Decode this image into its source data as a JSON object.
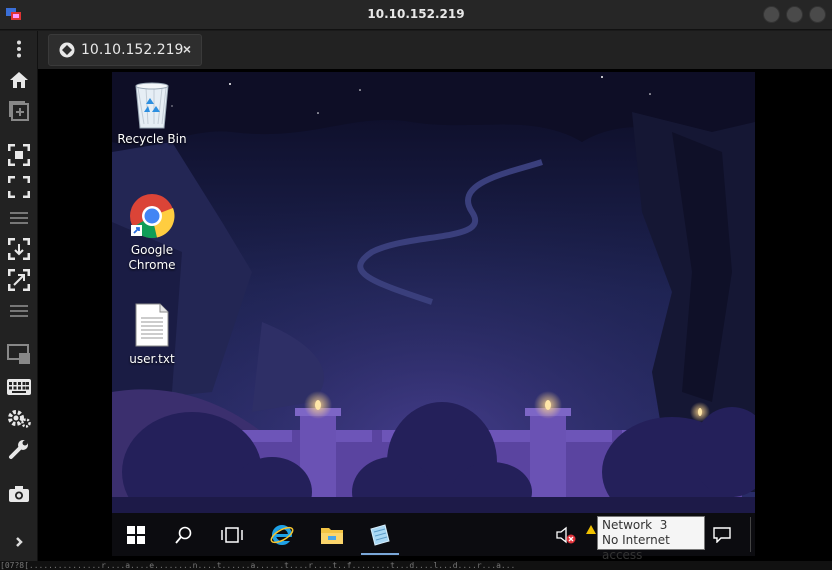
{
  "window": {
    "title": "10.10.152.219"
  },
  "tab": {
    "title": "10.10.152.219",
    "close": "×"
  },
  "sidebar": {
    "items": [
      {
        "icon": "kebab-menu-icon"
      },
      {
        "icon": "home-icon"
      },
      {
        "icon": "new-window-icon"
      },
      {
        "icon": "fit-screen-icon"
      },
      {
        "icon": "fullscreen-icon"
      },
      {
        "icon": "separator-icon"
      },
      {
        "icon": "shrink-icon"
      },
      {
        "icon": "expand-icon"
      },
      {
        "icon": "separator-icon"
      },
      {
        "icon": "display-icon"
      },
      {
        "icon": "keyboard-icon"
      },
      {
        "icon": "settings-icon"
      },
      {
        "icon": "wrench-icon"
      },
      {
        "icon": "camera-icon"
      },
      {
        "icon": "chevron-right-icon"
      }
    ]
  },
  "desktop": {
    "icons": [
      {
        "label": "Recycle Bin",
        "icon": "recycle-bin-icon"
      },
      {
        "label": "Google Chrome",
        "icon": "chrome-icon"
      },
      {
        "label": "user.txt",
        "icon": "text-file-icon"
      }
    ]
  },
  "taskbar": {
    "items": [
      "windows-start-icon",
      "search-icon",
      "task-view-icon",
      "internet-explorer-icon",
      "file-explorer-icon",
      "notepad-icon"
    ],
    "tray": [
      "volume-muted-icon",
      "network-warning-icon",
      "notification-icon"
    ]
  },
  "tooltip": {
    "line1": "Network  3",
    "line2": "No Internet access"
  },
  "status_line": "[07?8[...............r....a....e........n....t......a......t....r....t..f........t...d....l...d....r...a..."
}
